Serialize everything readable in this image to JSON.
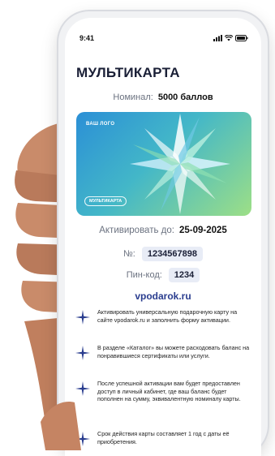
{
  "status_bar": {
    "time": "9:41"
  },
  "title": "МУЛЬТИКАРТА",
  "nominal": {
    "label": "Номинал:",
    "value": "5000 баллов"
  },
  "card": {
    "logo_text": "ВАШ ЛОГО",
    "badge_text": "МУЛЬТИКАРТА"
  },
  "activate": {
    "label": "Активировать до:",
    "value": "25-09-2025"
  },
  "number": {
    "label": "№:",
    "value": "1234567898"
  },
  "pin": {
    "label": "Пин-код:",
    "value": "1234"
  },
  "link": "vpodarok.ru",
  "instructions": [
    "Активировать универсальную подарочную карту на сайте vpodarok.ru и заполнить форму активации.",
    "В разделе «Каталог» вы можете расходовать баланс на понравившиеся сертификаты или услуги.",
    "После успешной активации вам будет предоставлен доступ в личный кабинет, где ваш баланс будет пополнен на сумму, эквивалентную номиналу карты.",
    "Срок действия карты составляет 1 год с даты её приобретения."
  ],
  "colors": {
    "brand": "#2a3d8f",
    "card_gradient_start": "#2b8fd6",
    "card_gradient_end": "#9ddf86"
  },
  "icons": [
    "signal-icon",
    "wifi-icon",
    "battery-icon",
    "star-bullet-icon"
  ]
}
